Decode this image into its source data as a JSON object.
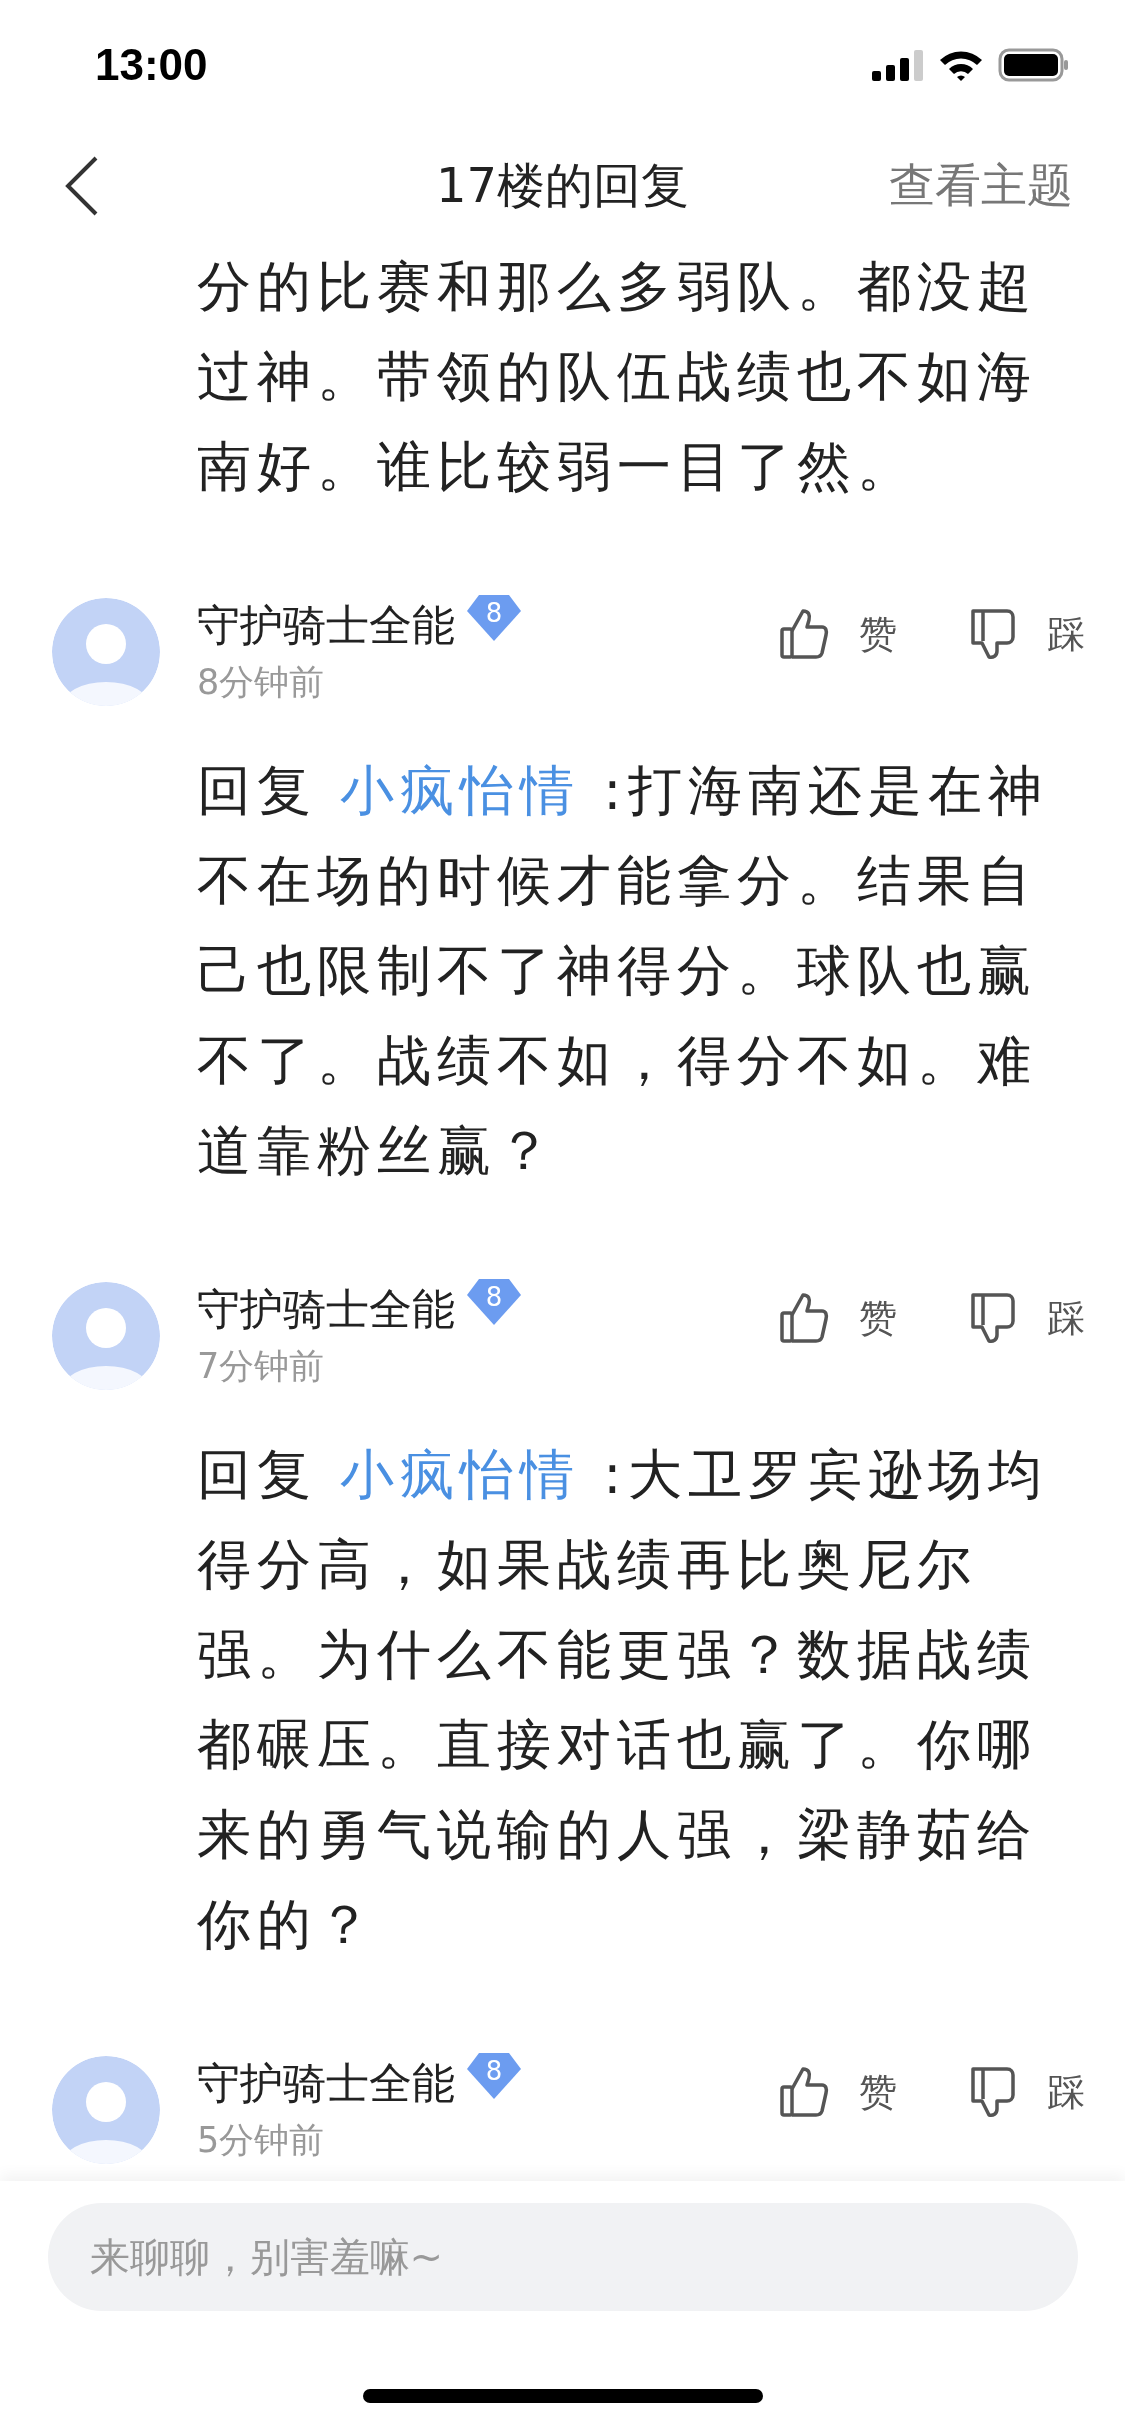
{
  "status_bar": {
    "time": "13:00"
  },
  "nav": {
    "title": "17楼的回复",
    "action": "查看主题"
  },
  "thread_text": "分的比赛和那么多弱队。都没超过神。带领的队伍战绩也不如海南好。谁比较弱一目了然。",
  "comments": [
    {
      "username": "守护骑士全能",
      "level": "8",
      "time": "8分钟前",
      "like_label": "赞",
      "dislike_label": "踩",
      "reply_prefix": "回复",
      "reply_to": "小疯怡情",
      "text": ":打海南还是在神不在场的时候才能拿分。结果自己也限制不了神得分。球队也赢不了。战绩不如，得分不如。难道靠粉丝赢？"
    },
    {
      "username": "守护骑士全能",
      "level": "8",
      "time": "7分钟前",
      "like_label": "赞",
      "dislike_label": "踩",
      "reply_prefix": "回复",
      "reply_to": "小疯怡情",
      "text": ":大卫罗宾逊场均得分高，如果战绩再比奥尼尔强。为什么不能更强？数据战绩都碾压。直接对话也赢了。你哪来的勇气说输的人强，梁静茹给你的？"
    },
    {
      "username": "守护骑士全能",
      "level": "8",
      "time": "5分钟前",
      "like_label": "赞",
      "dislike_label": "踩"
    }
  ],
  "input": {
    "placeholder": "来聊聊，别害羞嘛~"
  }
}
